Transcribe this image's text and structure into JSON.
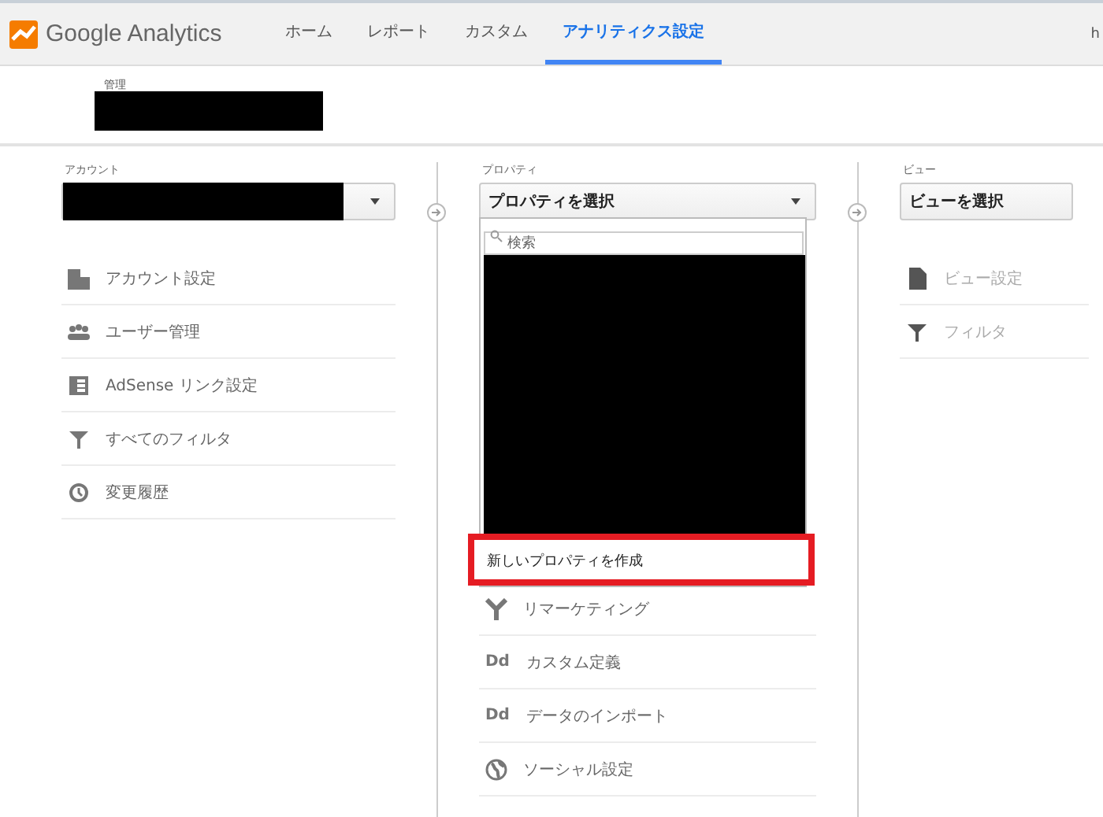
{
  "header": {
    "logo_text": "Google Analytics",
    "nav": [
      {
        "label": "ホーム",
        "selected": false
      },
      {
        "label": "レポート",
        "selected": false
      },
      {
        "label": "カスタム",
        "selected": false
      },
      {
        "label": "アナリティクス設定",
        "selected": true
      }
    ],
    "right_text": "h"
  },
  "title_label": "管理",
  "columns": [
    {
      "label": "アカウント",
      "items": [
        {
          "kind": "building",
          "label": "アカウント設定",
          "disabled": false
        },
        {
          "kind": "people",
          "label": "ユーザー管理",
          "disabled": false
        },
        {
          "kind": "table",
          "label": "AdSense リンク設定",
          "disabled": false
        },
        {
          "kind": "filter",
          "label": "すべてのフィルタ",
          "disabled": false
        },
        {
          "kind": "history",
          "label": "変更履歴",
          "disabled": false
        }
      ]
    },
    {
      "label": "プロパティ",
      "select_value": "プロパティを選択",
      "menu": {
        "search_placeholder": "検索",
        "create_label": "新しいプロパティを作成",
        "highlighted": true
      },
      "items": [
        {
          "kind": "fork",
          "label": "リマーケティング",
          "disabled": false
        },
        {
          "kind": "text",
          "icon_text": "Dd",
          "label": "カスタム定義",
          "disabled": false
        },
        {
          "kind": "text",
          "icon_text": "Dd",
          "label": "データのインポート",
          "disabled": false
        },
        {
          "kind": "globe",
          "label": "ソーシャル設定",
          "disabled": false
        }
      ]
    },
    {
      "label": "ビュー",
      "select_value": "ビューを選択",
      "items": [
        {
          "kind": "document",
          "label": "ビュー設定",
          "disabled": true
        },
        {
          "kind": "filter",
          "label": "フィルタ",
          "disabled": true
        }
      ]
    }
  ]
}
